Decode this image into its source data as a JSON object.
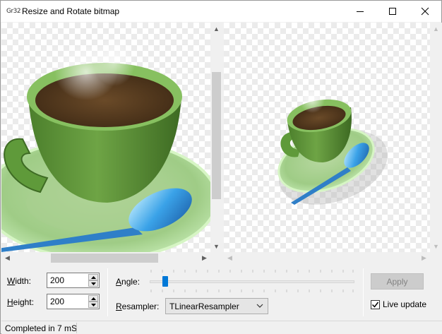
{
  "window": {
    "app_icon_text": "Gr32",
    "title": "Resize and Rotate bitmap",
    "minimize_icon": "minimize-icon",
    "maximize_icon": "maximize-icon",
    "close_icon": "close-icon"
  },
  "panes": {
    "left_image": "coffee-cup-original",
    "right_image": "coffee-cup-rotated"
  },
  "controls": {
    "width_label": "Width:",
    "width_accel": "W",
    "width_rest": "idth:",
    "width_value": "200",
    "height_label": "Height:",
    "height_accel": "H",
    "height_rest": "eight:",
    "height_value": "200",
    "angle_label": "Angle:",
    "angle_accel": "A",
    "angle_rest": "ngle:",
    "resampler_label": "Resampler:",
    "resampler_accel": "R",
    "resampler_rest": "esampler:",
    "resampler_value": "TLinearResampler",
    "apply_label": "Apply",
    "live_update_label": "Live update",
    "live_update_checked": true
  },
  "status": {
    "text": "Completed in 7 mS"
  },
  "colors": {
    "accent": "#0078d7",
    "checker": "#ebebeb"
  }
}
